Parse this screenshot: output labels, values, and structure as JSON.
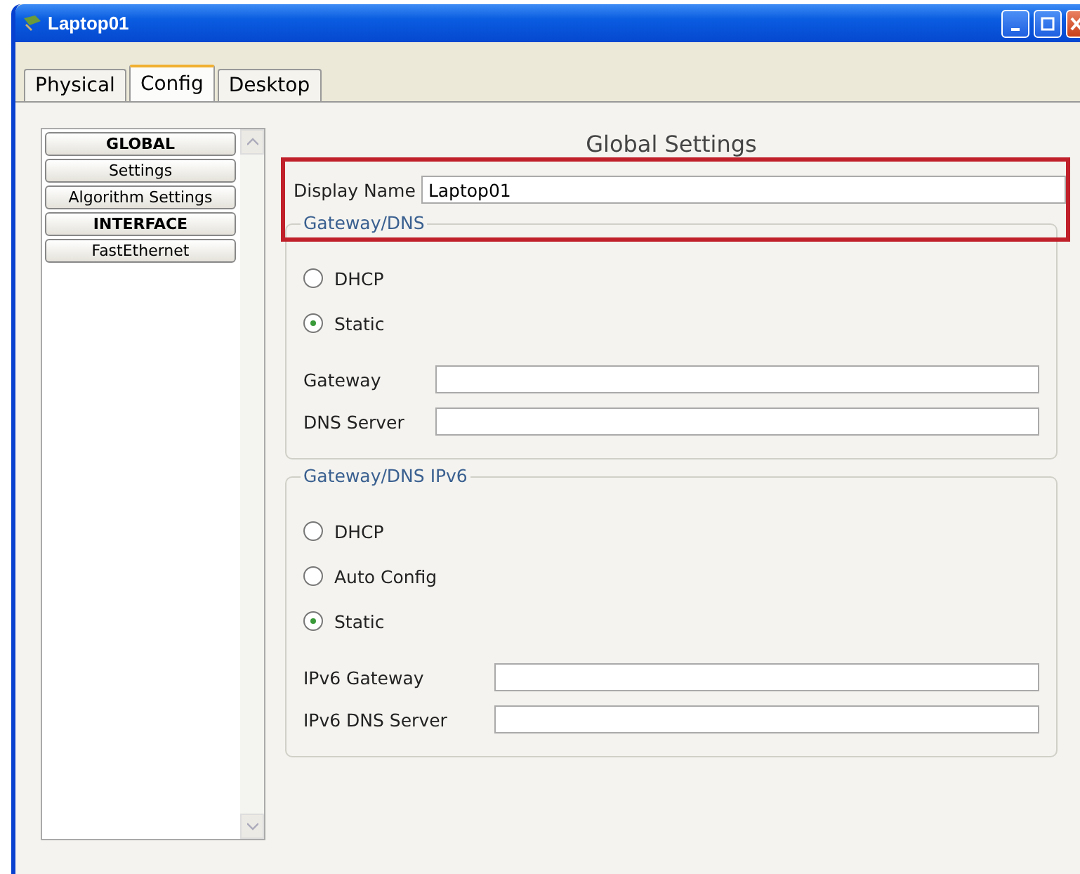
{
  "window": {
    "title": "Laptop01"
  },
  "tabs": [
    {
      "label": "Physical",
      "selected": false
    },
    {
      "label": "Config",
      "selected": true
    },
    {
      "label": "Desktop",
      "selected": false
    }
  ],
  "sidebar": {
    "items": [
      {
        "label": "GLOBAL",
        "kind": "header"
      },
      {
        "label": "Settings",
        "kind": "item"
      },
      {
        "label": "Algorithm Settings",
        "kind": "item"
      },
      {
        "label": "INTERFACE",
        "kind": "header"
      },
      {
        "label": "FastEthernet",
        "kind": "item"
      }
    ]
  },
  "panel": {
    "title": "Global Settings",
    "display_name": {
      "label": "Display Name",
      "value": "Laptop01"
    },
    "groups": [
      {
        "legend": "Gateway/DNS",
        "radios": [
          {
            "label": "DHCP",
            "selected": false
          },
          {
            "label": "Static",
            "selected": true
          }
        ],
        "fields": [
          {
            "label": "Gateway"
          },
          {
            "label": "DNS Server"
          }
        ]
      },
      {
        "legend": "Gateway/DNS IPv6",
        "radios": [
          {
            "label": "DHCP",
            "selected": false
          },
          {
            "label": "Auto Config",
            "selected": false
          },
          {
            "label": "Static",
            "selected": true
          }
        ],
        "fields": [
          {
            "label": "IPv6 Gateway"
          },
          {
            "label": "IPv6 DNS Server"
          }
        ]
      }
    ]
  },
  "annotation": {
    "kind": "highlight"
  }
}
